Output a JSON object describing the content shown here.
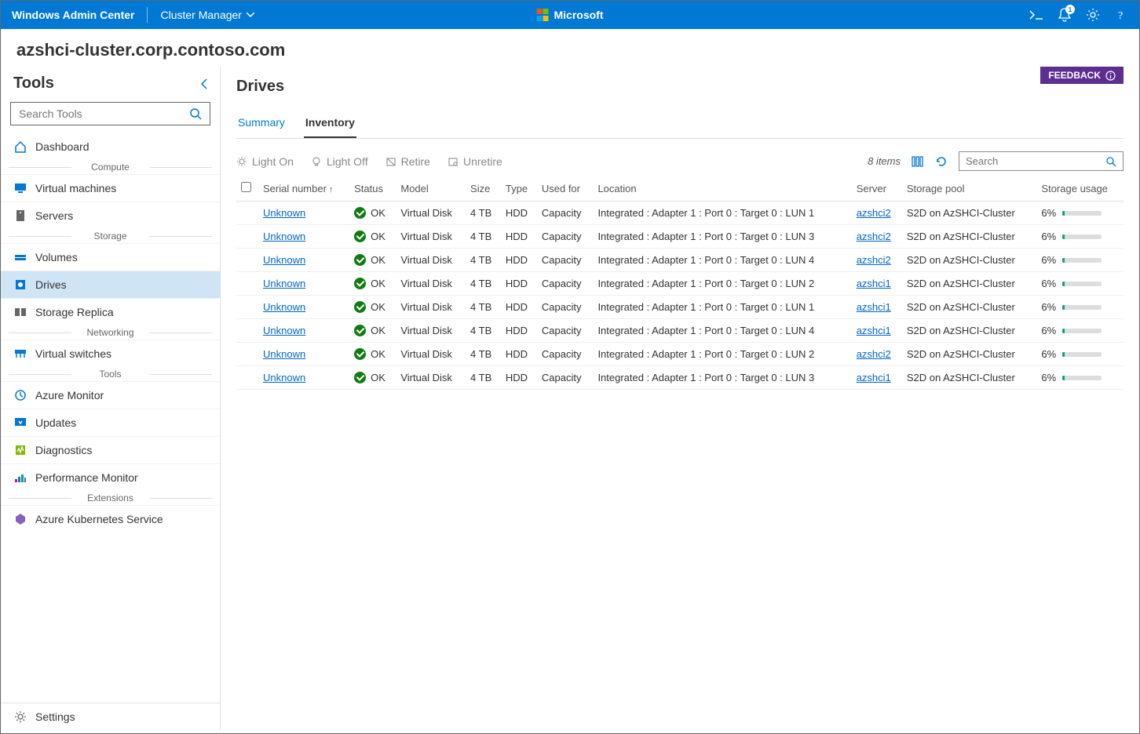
{
  "header": {
    "app_title": "Windows Admin Center",
    "context_label": "Cluster Manager",
    "brand_label": "Microsoft",
    "notification_count": "1"
  },
  "breadcrumb": "azshci-cluster.corp.contoso.com",
  "sidebar": {
    "title": "Tools",
    "search_placeholder": "Search Tools",
    "top_item": "Dashboard",
    "sections": [
      {
        "label": "Compute",
        "items": [
          "Virtual machines",
          "Servers"
        ]
      },
      {
        "label": "Storage",
        "items": [
          "Volumes",
          "Drives",
          "Storage Replica"
        ]
      },
      {
        "label": "Networking",
        "items": [
          "Virtual switches"
        ]
      },
      {
        "label": "Tools",
        "items": [
          "Azure Monitor",
          "Updates",
          "Diagnostics",
          "Performance Monitor"
        ]
      },
      {
        "label": "Extensions",
        "items": [
          "Azure Kubernetes Service"
        ]
      }
    ],
    "active_item": "Drives",
    "footer_item": "Settings"
  },
  "main": {
    "feedback_label": "FEEDBACK",
    "title": "Drives",
    "tabs": [
      {
        "label": "Summary",
        "active": false
      },
      {
        "label": "Inventory",
        "active": true
      }
    ],
    "toolbar": {
      "actions": [
        "Light On",
        "Light Off",
        "Retire",
        "Unretire"
      ],
      "items_count": "8 items",
      "search_placeholder": "Search"
    },
    "columns": [
      "Serial number",
      "Status",
      "Model",
      "Size",
      "Type",
      "Used for",
      "Location",
      "Server",
      "Storage pool",
      "Storage usage"
    ],
    "rows": [
      {
        "serial": "Unknown",
        "status": "OK",
        "model": "Virtual Disk",
        "size": "4 TB",
        "type": "HDD",
        "used_for": "Capacity",
        "location": "Integrated : Adapter 1 : Port 0 : Target 0 : LUN 1",
        "server": "azshci2",
        "pool": "S2D on AzSHCI-Cluster",
        "usage": "6%"
      },
      {
        "serial": "Unknown",
        "status": "OK",
        "model": "Virtual Disk",
        "size": "4 TB",
        "type": "HDD",
        "used_for": "Capacity",
        "location": "Integrated : Adapter 1 : Port 0 : Target 0 : LUN 3",
        "server": "azshci2",
        "pool": "S2D on AzSHCI-Cluster",
        "usage": "6%"
      },
      {
        "serial": "Unknown",
        "status": "OK",
        "model": "Virtual Disk",
        "size": "4 TB",
        "type": "HDD",
        "used_for": "Capacity",
        "location": "Integrated : Adapter 1 : Port 0 : Target 0 : LUN 4",
        "server": "azshci2",
        "pool": "S2D on AzSHCI-Cluster",
        "usage": "6%"
      },
      {
        "serial": "Unknown",
        "status": "OK",
        "model": "Virtual Disk",
        "size": "4 TB",
        "type": "HDD",
        "used_for": "Capacity",
        "location": "Integrated : Adapter 1 : Port 0 : Target 0 : LUN 2",
        "server": "azshci1",
        "pool": "S2D on AzSHCI-Cluster",
        "usage": "6%"
      },
      {
        "serial": "Unknown",
        "status": "OK",
        "model": "Virtual Disk",
        "size": "4 TB",
        "type": "HDD",
        "used_for": "Capacity",
        "location": "Integrated : Adapter 1 : Port 0 : Target 0 : LUN 1",
        "server": "azshci1",
        "pool": "S2D on AzSHCI-Cluster",
        "usage": "6%"
      },
      {
        "serial": "Unknown",
        "status": "OK",
        "model": "Virtual Disk",
        "size": "4 TB",
        "type": "HDD",
        "used_for": "Capacity",
        "location": "Integrated : Adapter 1 : Port 0 : Target 0 : LUN 4",
        "server": "azshci1",
        "pool": "S2D on AzSHCI-Cluster",
        "usage": "6%"
      },
      {
        "serial": "Unknown",
        "status": "OK",
        "model": "Virtual Disk",
        "size": "4 TB",
        "type": "HDD",
        "used_for": "Capacity",
        "location": "Integrated : Adapter 1 : Port 0 : Target 0 : LUN 2",
        "server": "azshci2",
        "pool": "S2D on AzSHCI-Cluster",
        "usage": "6%"
      },
      {
        "serial": "Unknown",
        "status": "OK",
        "model": "Virtual Disk",
        "size": "4 TB",
        "type": "HDD",
        "used_for": "Capacity",
        "location": "Integrated : Adapter 1 : Port 0 : Target 0 : LUN 3",
        "server": "azshci1",
        "pool": "S2D on AzSHCI-Cluster",
        "usage": "6%"
      }
    ]
  },
  "icons": {
    "dashboard": "#0078d4",
    "vm": "#0078d4",
    "servers": "#666",
    "volumes": "#0078d4",
    "drives": "#0078d4",
    "replica": "#666",
    "vswitch": "#0078d4",
    "azmon": "#0078d4",
    "updates": "#0078d4",
    "diag": "#7fba00",
    "perf": "#e3008c",
    "aks": "#8661c5",
    "settings": "#666"
  }
}
